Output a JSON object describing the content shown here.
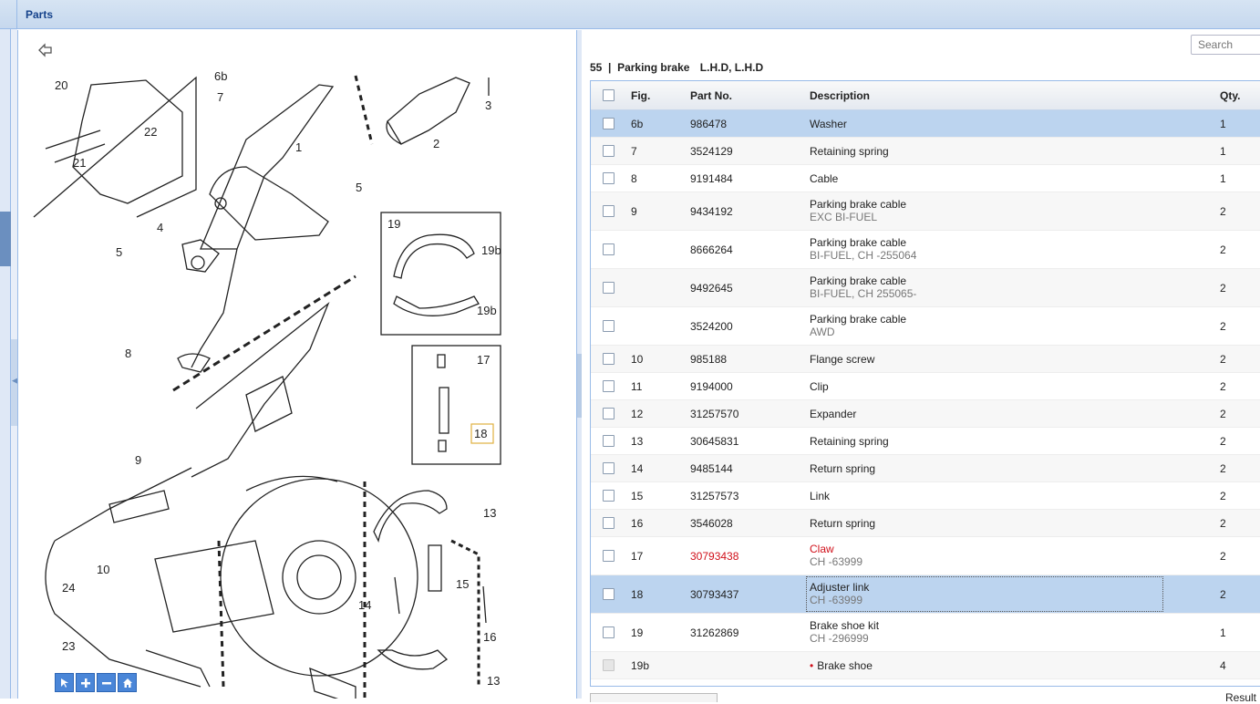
{
  "header": {
    "title": "Parts"
  },
  "search": {
    "placeholder": "Search"
  },
  "caption": {
    "group": "55",
    "name": "Parking brake",
    "variant": "L.H.D, L.H.D"
  },
  "columns": {
    "fig": "Fig.",
    "part_no": "Part No.",
    "description": "Description",
    "qty": "Qty."
  },
  "rows": [
    {
      "fig": "6b",
      "part_no": "986478",
      "description": "Washer",
      "sub": "",
      "qty": "1"
    },
    {
      "fig": "7",
      "part_no": "3524129",
      "description": "Retaining spring",
      "sub": "",
      "qty": "1"
    },
    {
      "fig": "8",
      "part_no": "9191484",
      "description": "Cable",
      "sub": "",
      "qty": "1"
    },
    {
      "fig": "9",
      "part_no": "9434192",
      "description": "Parking brake cable",
      "sub": "EXC BI-FUEL",
      "qty": "2"
    },
    {
      "fig": "",
      "part_no": "8666264",
      "description": "Parking brake cable",
      "sub": "BI-FUEL, CH -255064",
      "qty": "2"
    },
    {
      "fig": "",
      "part_no": "9492645",
      "description": "Parking brake cable",
      "sub": "BI-FUEL, CH 255065-",
      "qty": "2"
    },
    {
      "fig": "",
      "part_no": "3524200",
      "description": "Parking brake cable",
      "sub": "AWD",
      "qty": "2"
    },
    {
      "fig": "10",
      "part_no": "985188",
      "description": "Flange screw",
      "sub": "",
      "qty": "2"
    },
    {
      "fig": "11",
      "part_no": "9194000",
      "description": "Clip",
      "sub": "",
      "qty": "2"
    },
    {
      "fig": "12",
      "part_no": "31257570",
      "description": "Expander",
      "sub": "",
      "qty": "2"
    },
    {
      "fig": "13",
      "part_no": "30645831",
      "description": "Retaining spring",
      "sub": "",
      "qty": "2"
    },
    {
      "fig": "14",
      "part_no": "9485144",
      "description": "Return spring",
      "sub": "",
      "qty": "2"
    },
    {
      "fig": "15",
      "part_no": "31257573",
      "description": "Link",
      "sub": "",
      "qty": "2"
    },
    {
      "fig": "16",
      "part_no": "3546028",
      "description": "Return spring",
      "sub": "",
      "qty": "2"
    },
    {
      "fig": "17",
      "part_no": "30793438",
      "description": "Claw",
      "sub": "CH -63999",
      "qty": "2"
    },
    {
      "fig": "18",
      "part_no": "30793437",
      "description": "Adjuster link",
      "sub": "CH -63999",
      "qty": "2"
    },
    {
      "fig": "19",
      "part_no": "31262869",
      "description": "Brake shoe kit",
      "sub": "CH -296999",
      "qty": "1"
    },
    {
      "fig": "19b",
      "part_no": "",
      "description": "Brake shoe",
      "sub": "",
      "qty": "4"
    }
  ],
  "bullet": "•",
  "highlight_color": "#d0101a",
  "selected_color": "#bcd4ef",
  "footer": {
    "result_label": "Result"
  },
  "diagram": {
    "callouts": [
      "20",
      "6b",
      "7",
      "3",
      "22",
      "21",
      "1",
      "2",
      "4",
      "5",
      "5",
      "19",
      "19b",
      "19b",
      "8",
      "17",
      "18",
      "9",
      "13",
      "10",
      "24",
      "15",
      "14",
      "16",
      "23",
      "13"
    ],
    "zoom_icons": [
      "pointer-icon",
      "zoom-in-icon",
      "zoom-out-icon",
      "home-icon"
    ]
  }
}
